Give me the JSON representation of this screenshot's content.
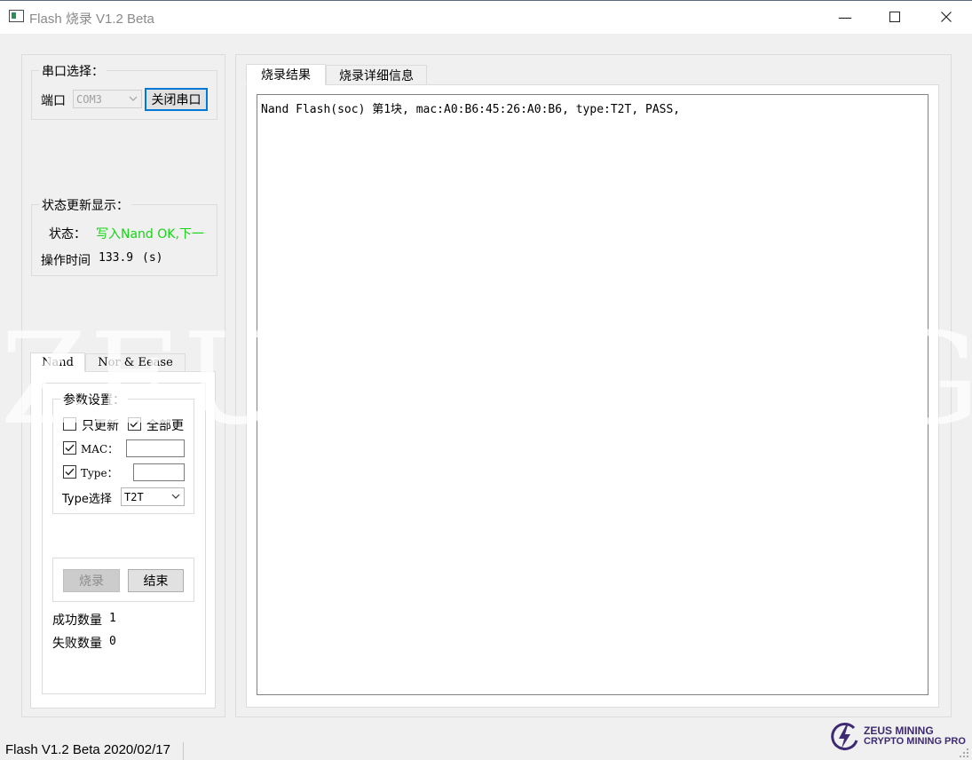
{
  "window": {
    "title": "Flash 烧录  V1.2 Beta",
    "controls": {
      "minimize": "—",
      "maximize": "☐",
      "close": "✕"
    }
  },
  "serial": {
    "group_title": "串口选择：",
    "port_label": "端口",
    "port_value": "COM3",
    "close_button": "关闭串口"
  },
  "status_box": {
    "group_title": "状态更新显示：",
    "status_label": "状态：",
    "status_value": "写入Nand OK,下一",
    "status_color": "#19d219",
    "time_label": "操作时间",
    "time_value": "133.9",
    "time_unit": "(s)"
  },
  "left_tabs": {
    "tabs": [
      {
        "label": "Nand",
        "active": true
      },
      {
        "label": "Nor & Eease",
        "active": false
      }
    ]
  },
  "params": {
    "group_title": "参数设置：",
    "only_update": {
      "label": "只更新",
      "checked": false
    },
    "all_update": {
      "label": "全部更",
      "checked": true
    },
    "mac": {
      "label": "MAC：",
      "checked": true,
      "value": ""
    },
    "type": {
      "label": "Type：",
      "checked": true,
      "value": ""
    },
    "type_select_label": "Type选择",
    "type_select_value": "T2T"
  },
  "actions": {
    "burn_button": "烧录",
    "end_button": "结束"
  },
  "counters": {
    "success_label": "成功数量",
    "success_value": "1",
    "fail_label": "失败数量",
    "fail_value": "0"
  },
  "right_tabs": {
    "tabs": [
      {
        "label": "烧录结果",
        "active": true
      },
      {
        "label": "烧录详细信息",
        "active": false
      }
    ]
  },
  "log": {
    "lines": [
      "Nand Flash(soc) 第1块, mac:A0:B6:45:26:A0:B6, type:T2T, PASS,"
    ]
  },
  "watermark": "ZEUS MINING",
  "statusbar": {
    "text": "Flash  V1.2 Beta  2020/02/17"
  },
  "logo": {
    "line1": "ZEUS MINING",
    "line2": "CRYPTO MINING PRO",
    "color": "#3d2a73",
    "icon": "lightning-bolt-icon"
  }
}
